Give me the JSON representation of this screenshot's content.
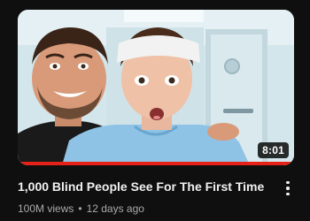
{
  "video": {
    "title": "1,000 Blind People See For The First Time",
    "views": "100M views",
    "separator": "•",
    "age": "12 days ago",
    "duration": "8:01",
    "watched_fraction": 1.0
  },
  "colors": {
    "background": "#0f0f0f",
    "progress": "#e62117",
    "title": "#f1f1f1",
    "meta": "#aaaaaa"
  },
  "icons": {
    "more": "more-vertical-icon"
  }
}
